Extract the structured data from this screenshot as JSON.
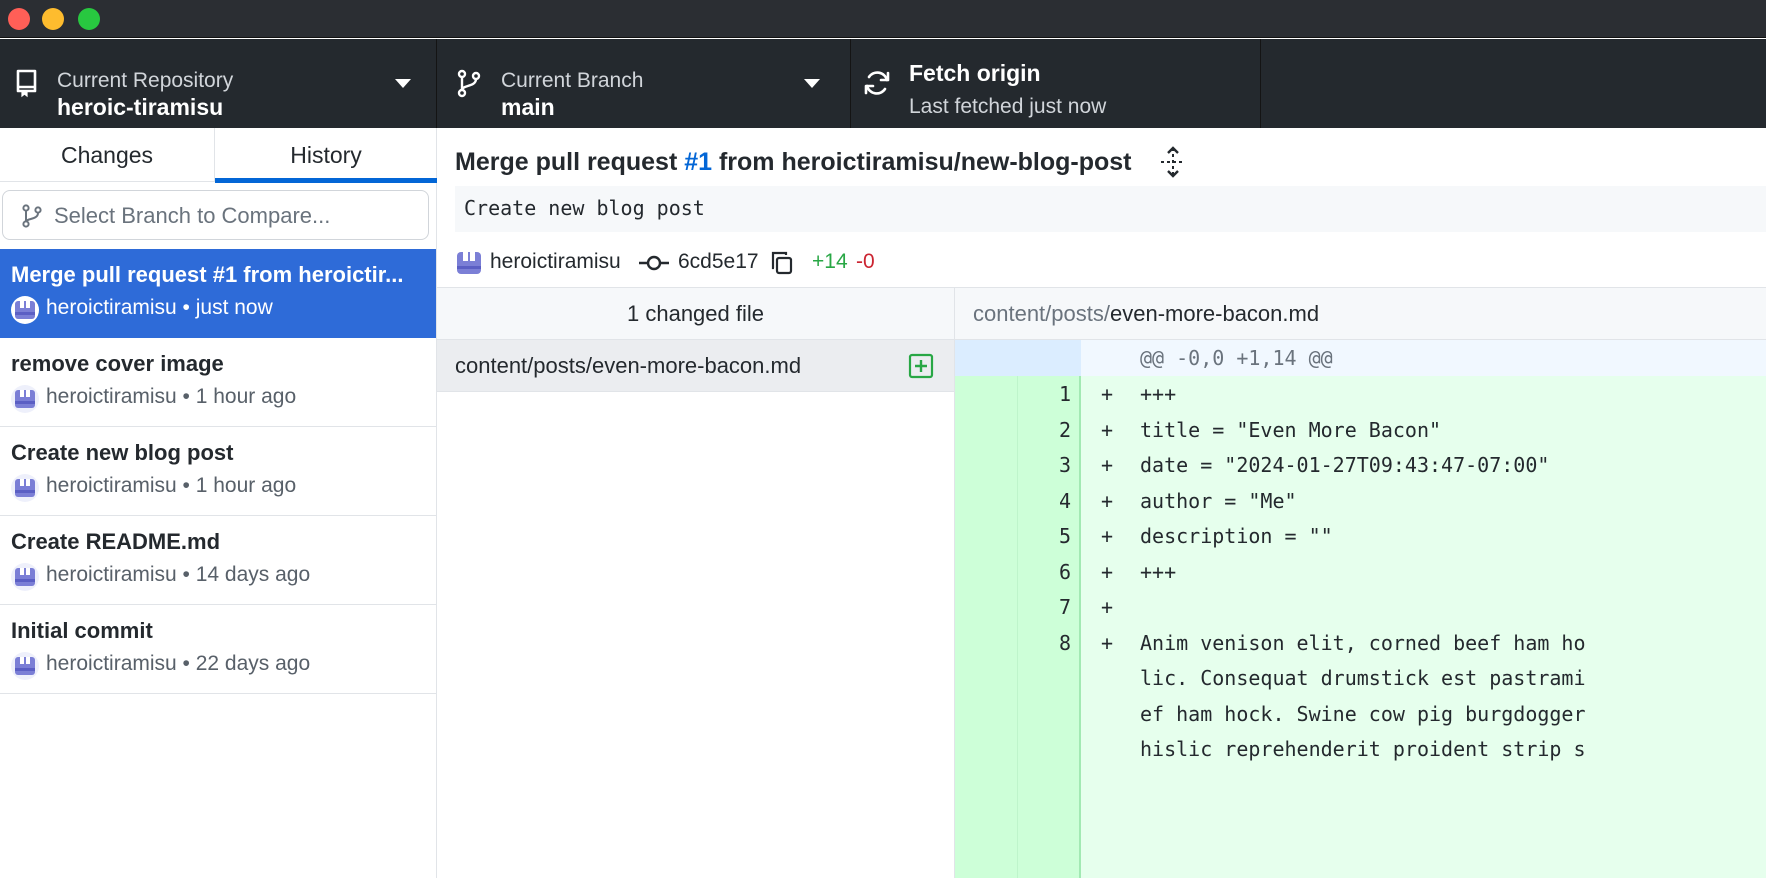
{
  "toolbar": {
    "repo_label": "Current Repository",
    "repo_value": "heroic-tiramisu",
    "branch_label": "Current Branch",
    "branch_value": "main",
    "fetch_title": "Fetch origin",
    "fetch_subtitle": "Last fetched just now"
  },
  "sidebar": {
    "tabs": [
      {
        "label": "Changes",
        "selected": false
      },
      {
        "label": "History",
        "selected": true
      }
    ],
    "compare_placeholder": "Select Branch to Compare...",
    "commits": [
      {
        "title": "Merge pull request #1 from heroictir...",
        "meta": "heroictiramisu • just now",
        "selected": true
      },
      {
        "title": "remove cover image",
        "meta": "heroictiramisu • 1 hour ago",
        "selected": false
      },
      {
        "title": "Create new blog post",
        "meta": "heroictiramisu • 1 hour ago",
        "selected": false
      },
      {
        "title": "Create README.md",
        "meta": "heroictiramisu • 14 days ago",
        "selected": false
      },
      {
        "title": "Initial commit",
        "meta": "heroictiramisu • 22 days ago",
        "selected": false
      }
    ]
  },
  "commit_detail": {
    "summary_prefix": "Merge pull request ",
    "summary_pr": "#1",
    "summary_suffix": " from heroictiramisu/new-blog-post",
    "description": "Create new blog post",
    "author": "heroictiramisu",
    "sha": "6cd5e17",
    "additions": "+14",
    "deletions": "-0"
  },
  "files": {
    "header": "1 changed file",
    "items": [
      {
        "path": "content/posts/even-more-bacon.md",
        "status": "added"
      }
    ]
  },
  "diff": {
    "path_dir": "content/posts/",
    "path_file": "even-more-bacon.md",
    "hunk_header": "@@ -0,0 +1,14 @@",
    "lines": [
      {
        "num": "1",
        "sign": "+",
        "code": "+++"
      },
      {
        "num": "2",
        "sign": "+",
        "code": "title = \"Even More Bacon\""
      },
      {
        "num": "3",
        "sign": "+",
        "code": "date = \"2024-01-27T09:43:47-07:00\""
      },
      {
        "num": "4",
        "sign": "+",
        "code": "author = \"Me\""
      },
      {
        "num": "5",
        "sign": "+",
        "code": "description = \"\""
      },
      {
        "num": "6",
        "sign": "+",
        "code": "+++"
      },
      {
        "num": "7",
        "sign": "+",
        "code": ""
      },
      {
        "num": "8",
        "sign": "+",
        "code": "Anim venison elit, corned beef ham ho"
      },
      {
        "num": "",
        "sign": "",
        "code": "lic. Consequat drumstick est pastrami"
      },
      {
        "num": "",
        "sign": "",
        "code": "ef ham hock. Swine cow pig burgdogger"
      },
      {
        "num": "",
        "sign": "",
        "code": "hislic reprehenderit proident strip s"
      }
    ]
  },
  "colors": {
    "toolbar_bg": "#24292e",
    "selected_commit_bg": "#2e6bd8",
    "accent_blue": "#0366d6",
    "added_green": "#28a745",
    "removed_red": "#cb2431",
    "diff_added_bg": "#e6ffed"
  }
}
